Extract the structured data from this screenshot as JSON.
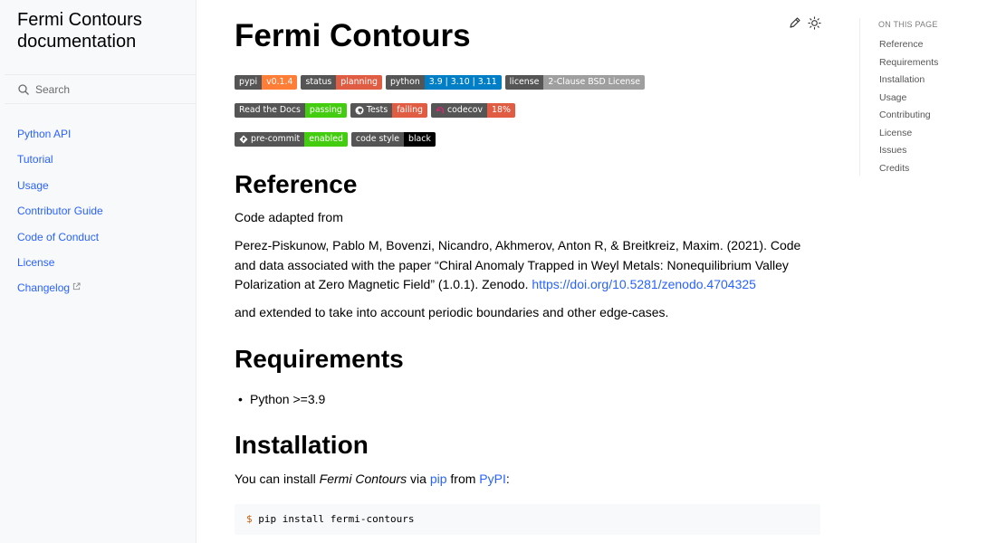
{
  "sidebar": {
    "brand": "Fermi Contours documentation",
    "search_placeholder": "Search",
    "items": [
      {
        "label": "Python API"
      },
      {
        "label": "Tutorial"
      },
      {
        "label": "Usage"
      },
      {
        "label": "Contributor Guide"
      },
      {
        "label": "Code of Conduct"
      },
      {
        "label": "License"
      },
      {
        "label": "Changelog",
        "external": true
      }
    ]
  },
  "header": {
    "title": "Fermi Contours",
    "icons": [
      "edit-icon",
      "theme-toggle-icon"
    ]
  },
  "badges": {
    "row1": [
      {
        "label": "pypi",
        "value": "v0.1.4",
        "color": "#fe7d37"
      },
      {
        "label": "status",
        "value": "planning",
        "color": "#e05d44"
      },
      {
        "label": "python",
        "value": "3.9 | 3.10 | 3.11",
        "color": "#007ec6"
      },
      {
        "label": "license",
        "value": "2-Clause BSD License",
        "color": "#9f9f9f"
      }
    ],
    "row2": [
      {
        "label": "Read the Docs",
        "value": "passing",
        "color": "#4c1"
      },
      {
        "label": "Tests",
        "value": "failing",
        "color": "#e05d44",
        "icon": "github-icon"
      },
      {
        "label": "codecov",
        "value": "18%",
        "color": "#e05d44",
        "icon": "codecov-icon"
      }
    ],
    "row3": [
      {
        "label": "pre-commit",
        "value": "enabled",
        "color": "#4c1",
        "icon": "pre-commit-icon"
      },
      {
        "label": "code style",
        "value": "black",
        "color": "#000000"
      }
    ]
  },
  "content": {
    "reference": {
      "heading": "Reference",
      "intro": "Code adapted from",
      "citation": "Perez-Piskunow, Pablo M, Bovenzi, Nicandro, Akhmerov, Anton R, & Breitkreiz, Maxim. (2021). Code and data associated with the paper “Chiral Anomaly Trapped in Weyl Metals: Nonequilibrium Valley Polarization at Zero Magnetic Field” (1.0.1). Zenodo.",
      "doi_link": "https://doi.org/10.5281/zenodo.4704325",
      "extended": "and extended to take into account periodic boundaries and other edge-cases."
    },
    "requirements": {
      "heading": "Requirements",
      "items": [
        "Python >=3.9"
      ]
    },
    "installation": {
      "heading": "Installation",
      "text_pre": "You can install",
      "text_em": "Fermi Contours",
      "text_via": "via",
      "pip_link": "pip",
      "text_from": "from",
      "pypi_link": "PyPI",
      "text_end": ":",
      "code_prompt": "$",
      "code": "pip install fermi-contours"
    }
  },
  "toc": {
    "title": "ON THIS PAGE",
    "items": [
      "Reference",
      "Requirements",
      "Installation",
      "Usage",
      "Contributing",
      "License",
      "Issues",
      "Credits"
    ]
  }
}
